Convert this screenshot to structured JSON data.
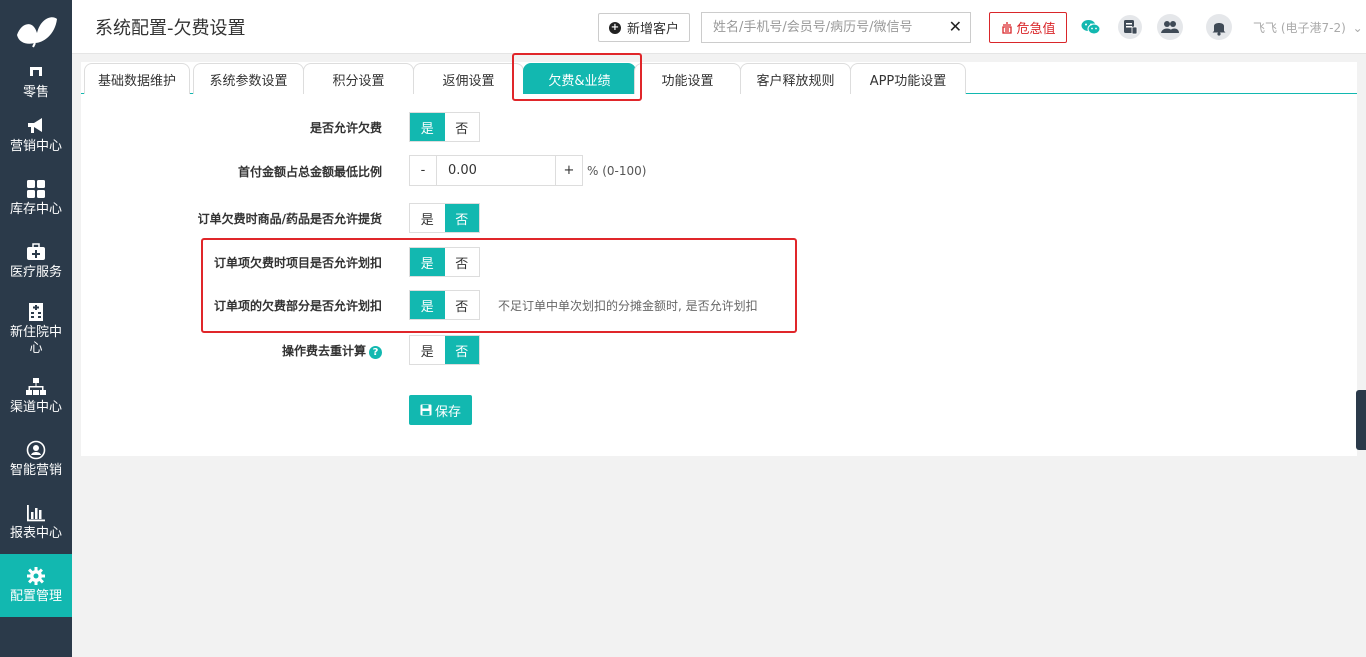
{
  "sidebar": {
    "items": [
      {
        "label": "零售",
        "icon": "retail-icon"
      },
      {
        "label": "营销中心",
        "icon": "megaphone-icon"
      },
      {
        "label": "库存中心",
        "icon": "grid-icon"
      },
      {
        "label": "医疗服务",
        "icon": "medical-kit-icon"
      },
      {
        "label": "新住院中心",
        "icon": "hospital-icon"
      },
      {
        "label": "渠道中心",
        "icon": "org-chart-icon"
      },
      {
        "label": "智能营销",
        "icon": "smart-user-icon"
      },
      {
        "label": "报表中心",
        "icon": "bar-chart-icon"
      },
      {
        "label": "配置管理",
        "icon": "gear-icon",
        "active": true
      }
    ]
  },
  "header": {
    "title": "系统配置-欠费设置",
    "new_customer": "新增客户",
    "search_placeholder": "姓名/手机号/会员号/病历号/微信号",
    "critical": "危急值",
    "user": "飞飞 (电子港7-2)"
  },
  "tabs": [
    "基础数据维护",
    "系统参数设置",
    "积分设置",
    "返佣设置",
    "欠费&业绩",
    "功能设置",
    "客户释放规则",
    "APP功能设置"
  ],
  "active_tab": "欠费&业绩",
  "form": {
    "yes": "是",
    "no": "否",
    "allow_debt": {
      "label": "是否允许欠费",
      "value": "是"
    },
    "min_ratio": {
      "label": "首付金额占总金额最低比例",
      "value": "0.00",
      "minus": "-",
      "plus": "+",
      "unit": "% (0-100)"
    },
    "allow_pickup": {
      "label": "订单欠费时商品/药品是否允许提货",
      "value": "否"
    },
    "item_deduct": {
      "label": "订单项欠费时项目是否允许划扣",
      "value": "是"
    },
    "partial_deduct": {
      "label": "订单项的欠费部分是否允许划扣",
      "value": "是",
      "hint": "不足订单中单次划扣的分摊金额时, 是否允许划扣"
    },
    "fee_dedup": {
      "label": "操作费去重计算",
      "value": "否"
    },
    "save": "保存"
  },
  "colors": {
    "accent": "#12b8b0",
    "sidebar": "#2b3a4a",
    "highlight": "#e0262a"
  }
}
